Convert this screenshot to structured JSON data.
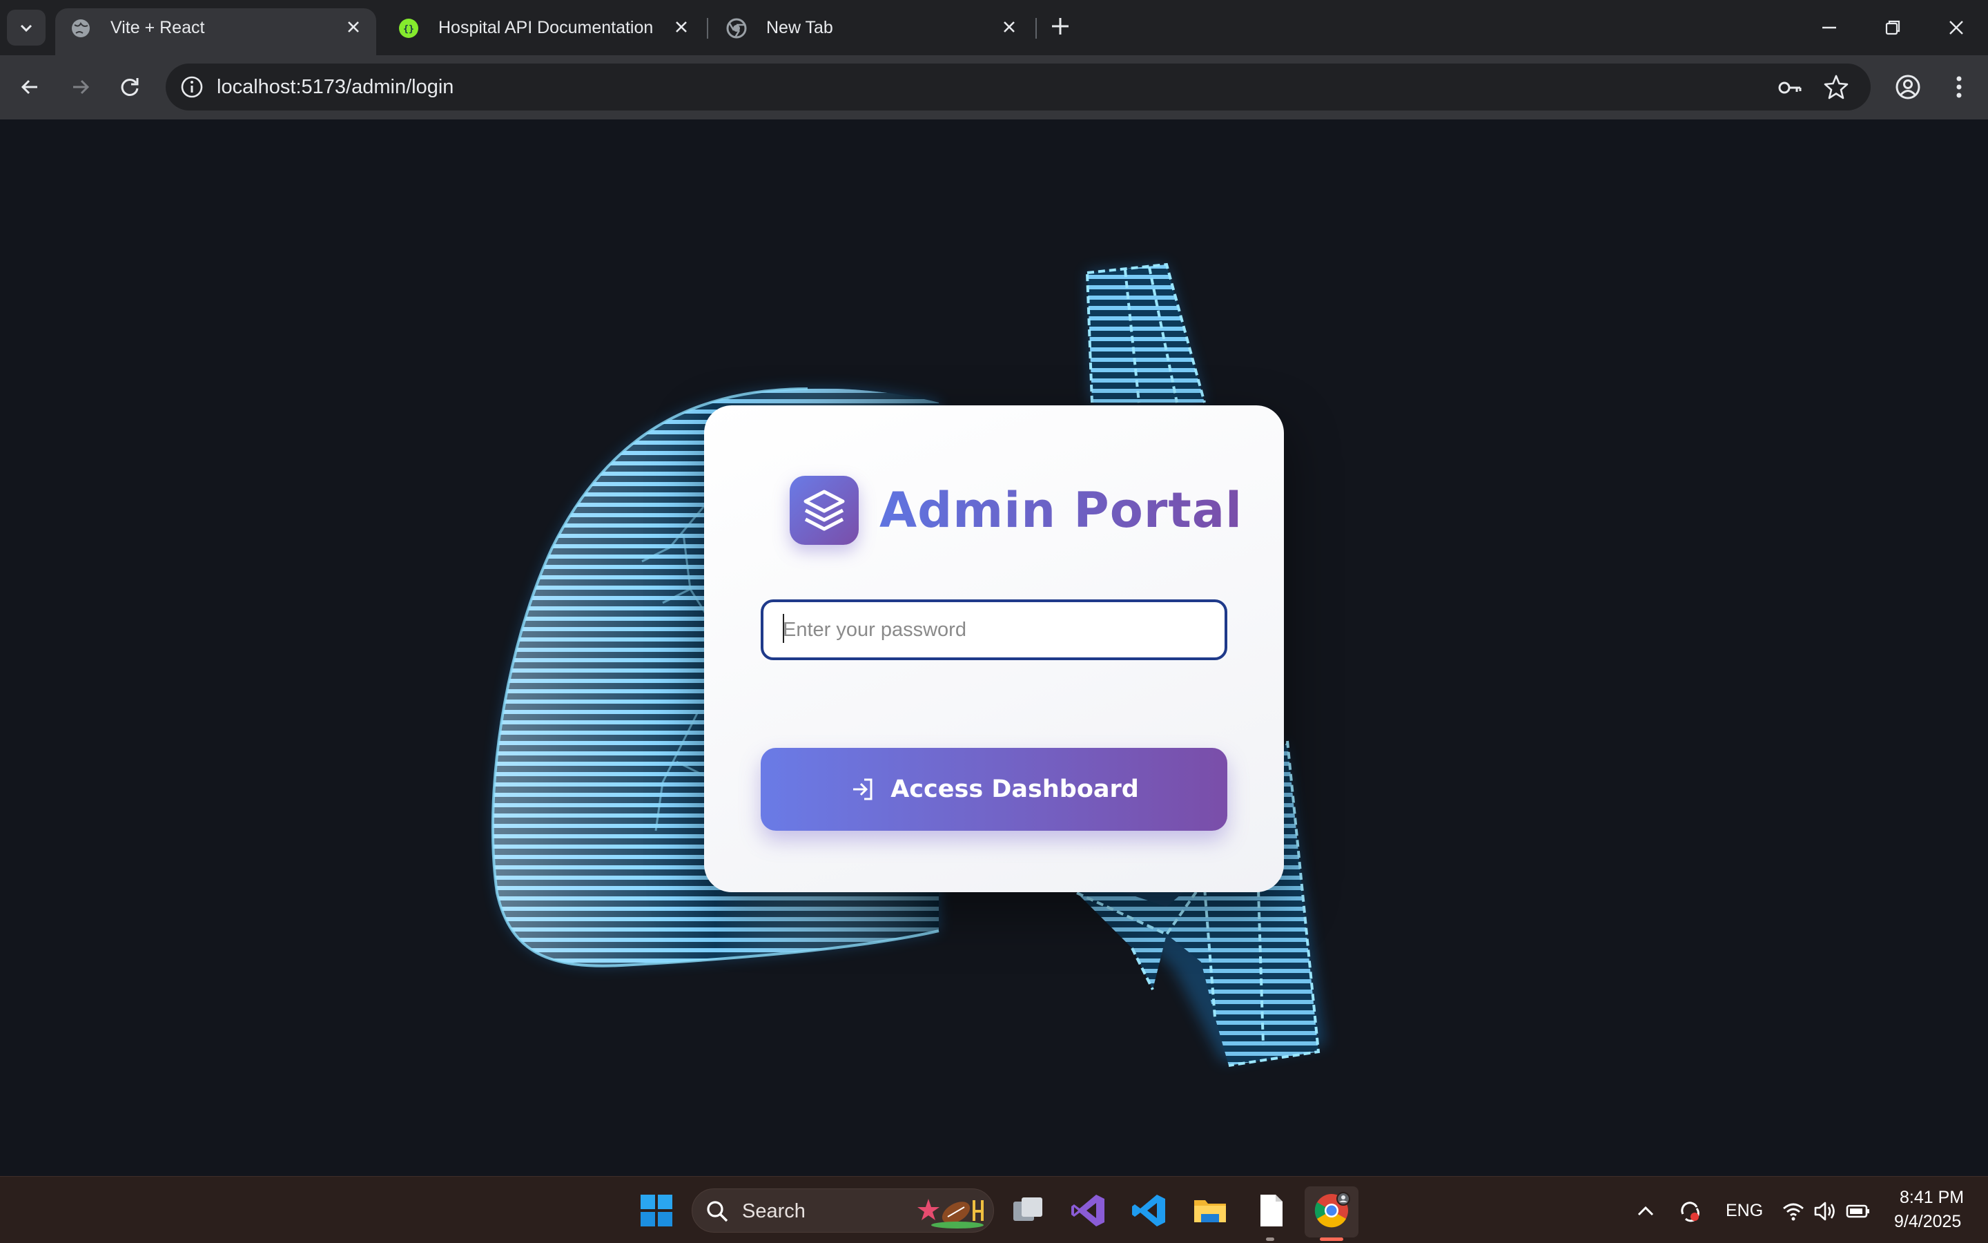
{
  "browser": {
    "tabs": [
      {
        "title": "Vite + React",
        "active": true,
        "favicon": "globe-icon"
      },
      {
        "title": "Hospital API Documentation",
        "active": false,
        "favicon": "swagger-icon"
      },
      {
        "title": "New Tab",
        "active": false,
        "favicon": "chrome-icon"
      }
    ],
    "url": "localhost:5173/admin/login"
  },
  "login": {
    "title": "Admin Portal",
    "password_placeholder": "Enter your password",
    "button_label": "Access Dashboard"
  },
  "taskbar": {
    "search_label": "Search",
    "language": "ENG",
    "time": "8:41 PM",
    "date": "9/4/2025"
  },
  "colors": {
    "accent_start": "#6a7be6",
    "accent_end": "#7a4ea9",
    "input_border": "#1f3a8a",
    "page_bg": "#12151c",
    "hero_glow": "#3fb6ff"
  }
}
